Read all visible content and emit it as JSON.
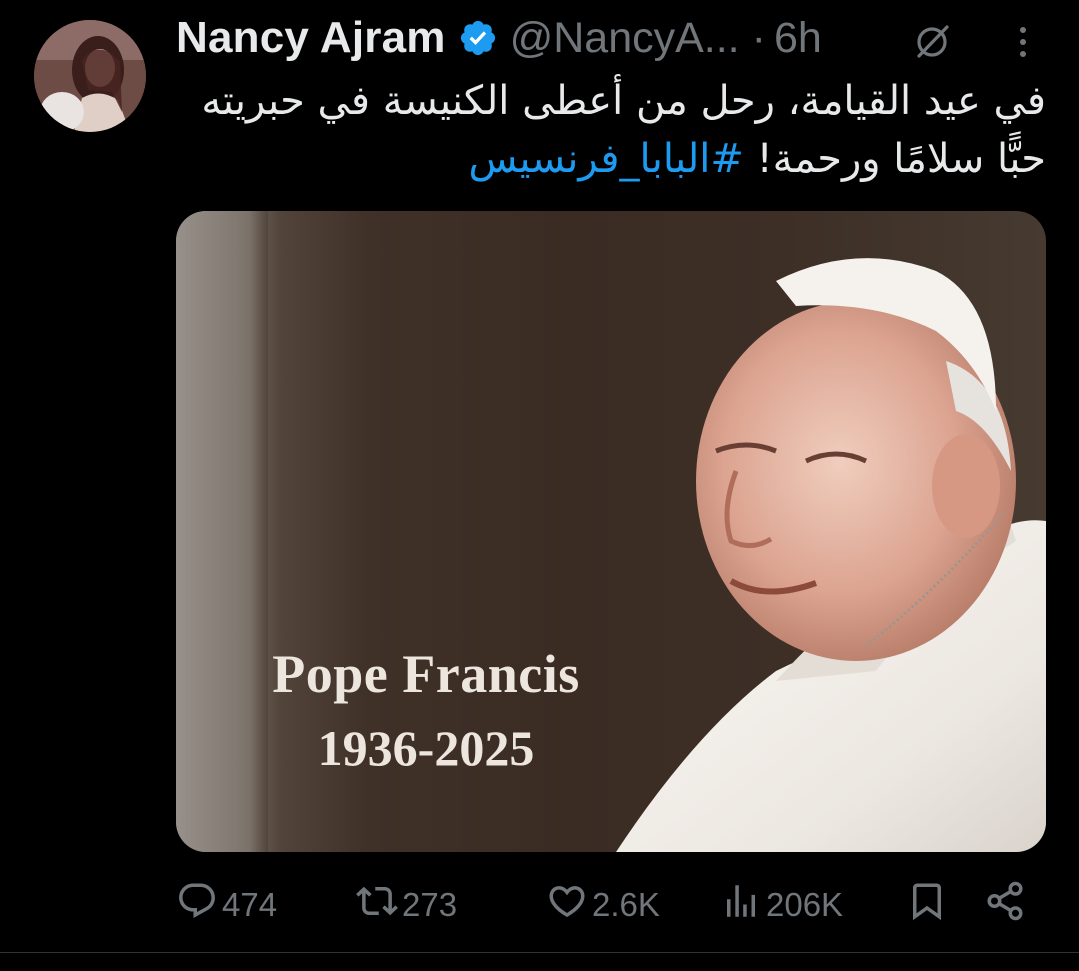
{
  "tweet": {
    "author_name": "Nancy Ajram",
    "handle": "@NancyA...",
    "separator": "·",
    "time": "6h",
    "text_line_1": "في عيد القيامة، رحل من أعطى الكنيسة في حبريته",
    "text_line_2": "حبًّا سلامًا ورحمة!",
    "hashtag": "#البابا_فرنسيس"
  },
  "media": {
    "title": "Pope Francis",
    "years": "1936-2025"
  },
  "actions": {
    "replies": "474",
    "reposts": "273",
    "likes": "2.6K",
    "views": "206K"
  },
  "colors": {
    "background": "#000000",
    "text": "#e7e9ea",
    "muted": "#71767b",
    "link": "#1d9bf0",
    "verified": "#1d9bf0"
  },
  "icons": {
    "verified": "verified-badge-icon",
    "grok": "grok-icon",
    "more": "more-options-icon",
    "reply": "reply-icon",
    "repost": "repost-icon",
    "like": "heart-icon",
    "views": "views-icon",
    "bookmark": "bookmark-icon",
    "share": "share-icon"
  }
}
